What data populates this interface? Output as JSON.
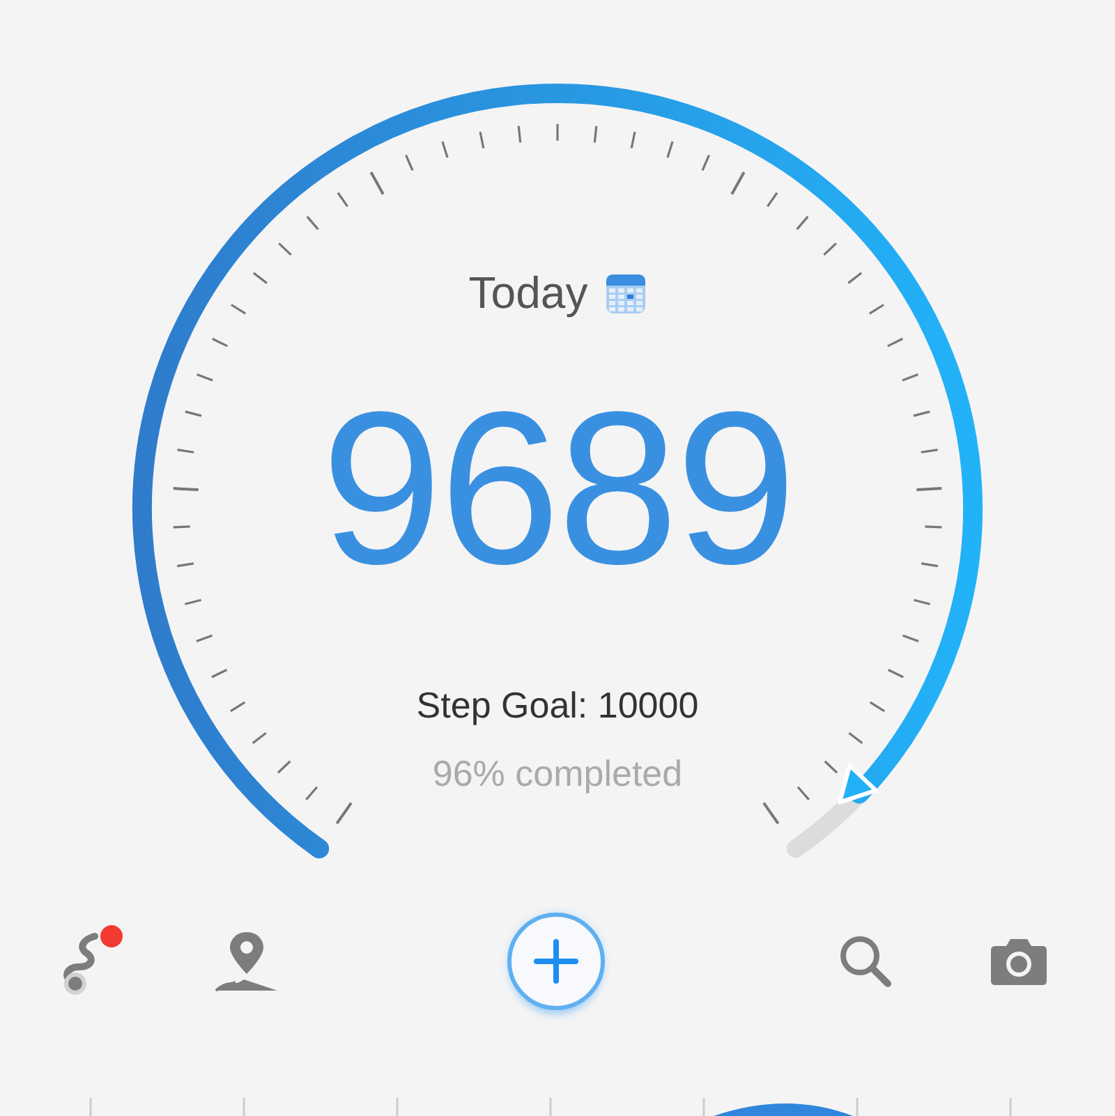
{
  "gauge": {
    "title": "Today",
    "steps": "9689",
    "goal": "Step Goal: 10000",
    "completed": "96% completed"
  },
  "toolbar": [
    {
      "kind": "route",
      "notification": true
    },
    {
      "kind": "map"
    },
    {
      "kind": "add"
    },
    {
      "kind": "search"
    },
    {
      "kind": "camera"
    }
  ]
}
